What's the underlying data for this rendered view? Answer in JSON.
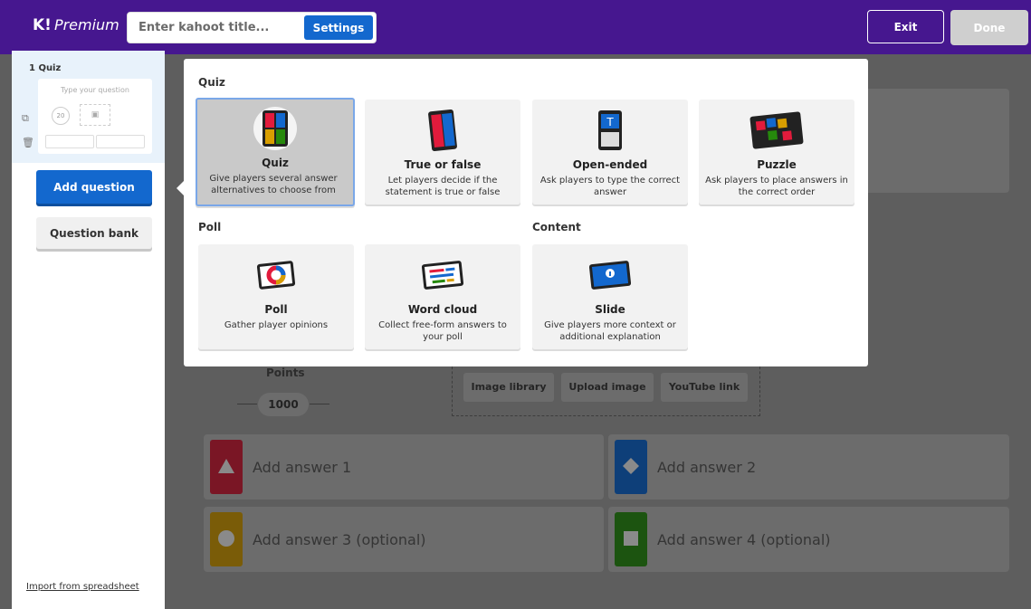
{
  "topbar": {
    "logo_k": "K!",
    "logo_text": "Premium",
    "title_placeholder": "Enter kahoot title...",
    "settings_label": "Settings",
    "exit_label": "Exit",
    "done_label": "Done"
  },
  "sidebar": {
    "question_number": "1 Quiz",
    "thumb_question": "Type your question",
    "thumb_timer": "20",
    "add_question_label": "Add question",
    "question_bank_label": "Question bank",
    "import_label": "Import from spreadsheet"
  },
  "editor": {
    "points_label": "Points",
    "points_value": "1000",
    "media_buttons": [
      "Image library",
      "Upload image",
      "YouTube link"
    ],
    "answers": [
      {
        "label": "Add answer 1",
        "color": "#e21b3c"
      },
      {
        "label": "Add answer 2",
        "color": "#1368ce"
      },
      {
        "label": "Add answer 3 (optional)",
        "color": "#d89e00"
      },
      {
        "label": "Add answer 4 (optional)",
        "color": "#26890c"
      }
    ]
  },
  "modal": {
    "sections": {
      "quiz": "Quiz",
      "poll": "Poll",
      "content": "Content"
    },
    "tiles": {
      "quiz": {
        "title": "Quiz",
        "desc": "Give players several answer alternatives to choose from",
        "icon": "quiz-icon"
      },
      "true_false": {
        "title": "True or false",
        "desc": "Let players decide if the statement is true or false",
        "icon": "true-false-icon"
      },
      "open_ended": {
        "title": "Open-ended",
        "desc": "Ask players to type the correct answer",
        "icon": "open-ended-icon"
      },
      "puzzle": {
        "title": "Puzzle",
        "desc": "Ask players to place answers in the correct order",
        "icon": "puzzle-icon"
      },
      "poll": {
        "title": "Poll",
        "desc": "Gather player opinions",
        "icon": "poll-icon"
      },
      "word_cloud": {
        "title": "Word cloud",
        "desc": "Collect free-form answers to your poll",
        "icon": "word-cloud-icon"
      },
      "slide": {
        "title": "Slide",
        "desc": "Give players more context or additional explanation",
        "icon": "slide-icon"
      }
    }
  },
  "colors": {
    "brand_purple": "#46178f",
    "accent_blue": "#1368ce",
    "red": "#e21b3c",
    "blue": "#1368ce",
    "yellow": "#d89e00",
    "green": "#26890c"
  }
}
